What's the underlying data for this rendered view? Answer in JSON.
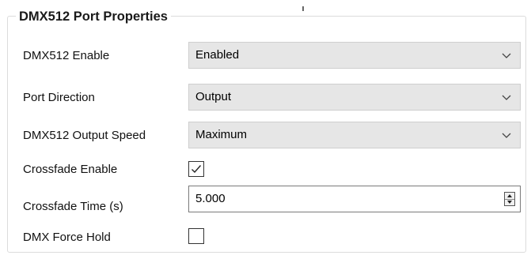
{
  "group": {
    "title": "DMX512 Port Properties"
  },
  "rows": {
    "dmx_enable": {
      "label": "DMX512 Enable",
      "value": "Enabled"
    },
    "port_direction": {
      "label": "Port Direction",
      "value": "Output"
    },
    "output_speed": {
      "label": "DMX512 Output Speed",
      "value": "Maximum"
    },
    "crossfade_enable": {
      "label": "Crossfade Enable",
      "checked": true
    },
    "crossfade_time": {
      "label": "Crossfade Time (s)",
      "value": "5.000"
    },
    "force_hold": {
      "label": "DMX Force Hold",
      "checked": false
    }
  },
  "icons": {
    "dropdown": "chevron-down-icon",
    "check": "checkmark-icon",
    "spin": "spin-arrows-icon"
  },
  "colors": {
    "combo_bg": "#e6e6e6",
    "group_border": "#dcdcdc",
    "text": "#111111"
  }
}
